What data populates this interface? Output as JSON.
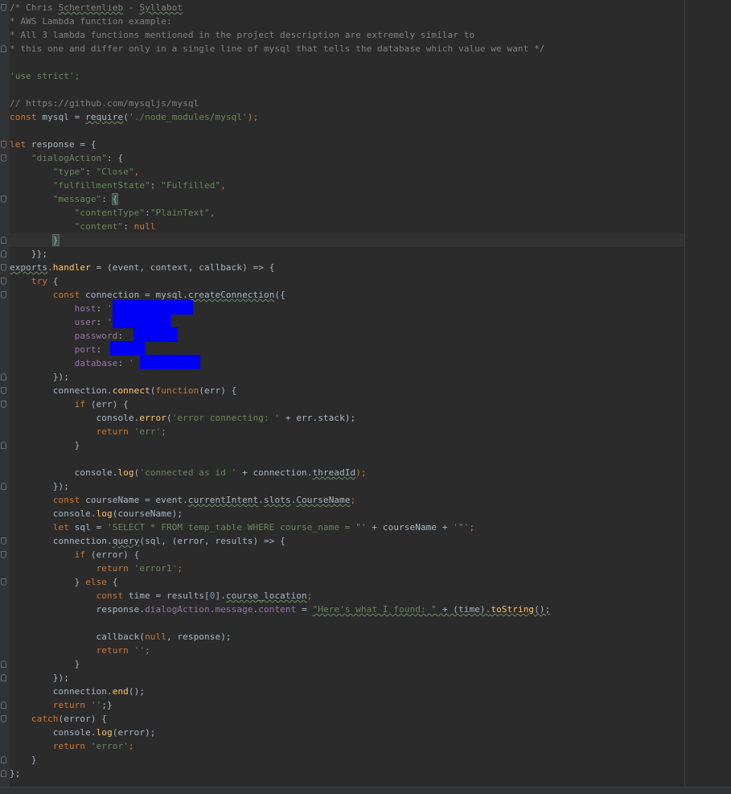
{
  "editor": {
    "colors": {
      "background": "#2b2b2b",
      "gutter": "#313335",
      "comment": "#808080",
      "keyword": "#cc7832",
      "string": "#6a8759",
      "property": "#9876aa",
      "function": "#ffc66d",
      "plain": "#a9b7c6",
      "redaction": "#0000f6"
    },
    "lines": [
      {
        "fold": "start",
        "tokens": [
          {
            "t": "/* Chris ",
            "c": "comment"
          },
          {
            "t": "Schertenlieb",
            "c": "comment typo"
          },
          {
            "t": " - ",
            "c": "comment"
          },
          {
            "t": "Syllabot",
            "c": "comment typo"
          }
        ]
      },
      {
        "tokens": [
          {
            "t": "* AWS Lambda function example:",
            "c": "comment"
          }
        ]
      },
      {
        "tokens": [
          {
            "t": "* All 3 lambda functions mentioned in the project description are extremely similar to",
            "c": "comment"
          }
        ]
      },
      {
        "fold": "end",
        "tokens": [
          {
            "t": "* this one and differ only in a single line of mysql that tells the database which value we want */",
            "c": "comment"
          }
        ]
      },
      {
        "tokens": []
      },
      {
        "tokens": [
          {
            "t": "'use strict';",
            "c": "str"
          }
        ]
      },
      {
        "tokens": []
      },
      {
        "tokens": [
          {
            "t": "// https://github.com/mysqljs/mysql",
            "c": "comment"
          }
        ]
      },
      {
        "tokens": [
          {
            "t": "const",
            "c": "kw"
          },
          {
            "t": " mysql = ",
            "c": "plain"
          },
          {
            "t": "require",
            "c": "plain typo"
          },
          {
            "t": "(",
            "c": "plain"
          },
          {
            "t": "'./node_modules/mysql'",
            "c": "str"
          },
          {
            "t": ");",
            "c": "kw"
          }
        ]
      },
      {
        "tokens": []
      },
      {
        "fold": "start",
        "tokens": [
          {
            "t": "let",
            "c": "kw"
          },
          {
            "t": " response = {",
            "c": "plain"
          }
        ]
      },
      {
        "fold": "start",
        "tokens": [
          {
            "t": "    ",
            "c": "plain"
          },
          {
            "t": "\"dialogAction\"",
            "c": "str"
          },
          {
            "t": ": {",
            "c": "plain"
          }
        ]
      },
      {
        "tokens": [
          {
            "t": "        ",
            "c": "plain"
          },
          {
            "t": "\"type\"",
            "c": "str"
          },
          {
            "t": ": ",
            "c": "plain"
          },
          {
            "t": "\"Close\"",
            "c": "str"
          },
          {
            "t": ",",
            "c": "kw"
          }
        ]
      },
      {
        "tokens": [
          {
            "t": "        ",
            "c": "plain"
          },
          {
            "t": "\"fulfillmentState\"",
            "c": "str"
          },
          {
            "t": ": ",
            "c": "plain"
          },
          {
            "t": "\"Fulfilled\"",
            "c": "str"
          },
          {
            "t": ",",
            "c": "kw"
          }
        ]
      },
      {
        "fold": "start",
        "tokens": [
          {
            "t": "        ",
            "c": "plain"
          },
          {
            "t": "\"message\"",
            "c": "str"
          },
          {
            "t": ": ",
            "c": "plain"
          },
          {
            "t": "{",
            "c": "plain match"
          }
        ]
      },
      {
        "tokens": [
          {
            "t": "            ",
            "c": "plain"
          },
          {
            "t": "\"contentType\"",
            "c": "str"
          },
          {
            "t": ":",
            "c": "plain"
          },
          {
            "t": "\"PlainText\"",
            "c": "str"
          },
          {
            "t": ",",
            "c": "kw"
          }
        ]
      },
      {
        "tokens": [
          {
            "t": "            ",
            "c": "plain"
          },
          {
            "t": "\"content\"",
            "c": "str"
          },
          {
            "t": ": ",
            "c": "plain"
          },
          {
            "t": "null",
            "c": "kw"
          }
        ]
      },
      {
        "fold": "end",
        "current": true,
        "tokens": [
          {
            "t": "        ",
            "c": "plain"
          },
          {
            "t": "}",
            "c": "plain match"
          }
        ]
      },
      {
        "fold": "end",
        "tokens": [
          {
            "t": "    }};",
            "c": "plain"
          }
        ]
      },
      {
        "fold": "start",
        "tokens": [
          {
            "t": "exports",
            "c": "plain typo"
          },
          {
            "t": ".",
            "c": "plain"
          },
          {
            "t": "handler",
            "c": "fn"
          },
          {
            "t": " = (event, context, callback) => {",
            "c": "plain"
          }
        ]
      },
      {
        "fold": "start",
        "tokens": [
          {
            "t": "    ",
            "c": "plain"
          },
          {
            "t": "try",
            "c": "kw"
          },
          {
            "t": " {",
            "c": "plain"
          }
        ]
      },
      {
        "fold": "start",
        "tokens": [
          {
            "t": "        ",
            "c": "plain"
          },
          {
            "t": "const",
            "c": "kw"
          },
          {
            "t": " connection = mysql.",
            "c": "plain"
          },
          {
            "t": "createConnection",
            "c": "plain typo"
          },
          {
            "t": "({",
            "c": "plain"
          }
        ]
      },
      {
        "redact": [
          140,
          100
        ],
        "tokens": [
          {
            "t": "            ",
            "c": "plain"
          },
          {
            "t": "host",
            "c": "prop"
          },
          {
            "t": ": ",
            "c": "plain"
          },
          {
            "t": "'",
            "c": "str"
          },
          {
            "t": "              ",
            "c": "plain"
          },
          {
            "t": ",",
            "c": "kw"
          }
        ]
      },
      {
        "redact": [
          140,
          73
        ],
        "tokens": [
          {
            "t": "            ",
            "c": "plain"
          },
          {
            "t": "user",
            "c": "prop"
          },
          {
            "t": ": ",
            "c": "plain"
          },
          {
            "t": "'",
            "c": "str"
          },
          {
            "t": "          ",
            "c": "plain"
          },
          {
            "t": ",",
            "c": "kw"
          }
        ]
      },
      {
        "redact": [
          166,
          55
        ],
        "tokens": [
          {
            "t": "            ",
            "c": "plain"
          },
          {
            "t": "password",
            "c": "prop"
          },
          {
            "t": ": ",
            "c": "plain"
          },
          {
            "t": "        ",
            "c": "plain"
          },
          {
            "t": ",",
            "c": "kw"
          }
        ]
      },
      {
        "redact": [
          137,
          44
        ],
        "tokens": [
          {
            "t": "            ",
            "c": "plain"
          },
          {
            "t": "port",
            "c": "prop"
          },
          {
            "t": ": ",
            "c": "plain"
          },
          {
            "t": "      ",
            "c": "plain"
          },
          {
            "t": ",",
            "c": "kw"
          }
        ]
      },
      {
        "redact": [
          174,
          75
        ],
        "tokens": [
          {
            "t": "            ",
            "c": "plain"
          },
          {
            "t": "database",
            "c": "prop"
          },
          {
            "t": ": ",
            "c": "plain"
          },
          {
            "t": "'",
            "c": "str"
          }
        ]
      },
      {
        "fold": "end",
        "tokens": [
          {
            "t": "        ",
            "c": "plain"
          },
          {
            "t": "});",
            "c": "plain"
          }
        ]
      },
      {
        "fold": "start",
        "tokens": [
          {
            "t": "        connection.",
            "c": "plain"
          },
          {
            "t": "connect",
            "c": "fn"
          },
          {
            "t": "(",
            "c": "plain"
          },
          {
            "t": "function",
            "c": "kw"
          },
          {
            "t": "(err) {",
            "c": "plain"
          }
        ]
      },
      {
        "fold": "start",
        "tokens": [
          {
            "t": "            ",
            "c": "plain"
          },
          {
            "t": "if",
            "c": "kw"
          },
          {
            "t": " (err) {",
            "c": "plain"
          }
        ]
      },
      {
        "tokens": [
          {
            "t": "                console.",
            "c": "plain"
          },
          {
            "t": "error",
            "c": "fn"
          },
          {
            "t": "(",
            "c": "plain"
          },
          {
            "t": "'error connecting: '",
            "c": "str"
          },
          {
            "t": " + err.stack);",
            "c": "plain"
          }
        ]
      },
      {
        "tokens": [
          {
            "t": "                ",
            "c": "plain"
          },
          {
            "t": "return",
            "c": "kw"
          },
          {
            "t": " ",
            "c": "plain"
          },
          {
            "t": "'err'",
            "c": "str"
          },
          {
            "t": ";",
            "c": "kw"
          }
        ]
      },
      {
        "fold": "end",
        "tokens": [
          {
            "t": "            }",
            "c": "plain"
          }
        ]
      },
      {
        "tokens": []
      },
      {
        "tokens": [
          {
            "t": "            console.",
            "c": "plain"
          },
          {
            "t": "log",
            "c": "fn"
          },
          {
            "t": "(",
            "c": "plain"
          },
          {
            "t": "'connected as id '",
            "c": "str"
          },
          {
            "t": " + connection.",
            "c": "plain"
          },
          {
            "t": "threadId",
            "c": "plain typo"
          },
          {
            "t": ");",
            "c": "kw"
          }
        ]
      },
      {
        "fold": "end",
        "tokens": [
          {
            "t": "        });",
            "c": "plain"
          }
        ]
      },
      {
        "tokens": [
          {
            "t": "        ",
            "c": "plain"
          },
          {
            "t": "const",
            "c": "kw"
          },
          {
            "t": " courseName = event.",
            "c": "plain"
          },
          {
            "t": "currentIntent",
            "c": "plain typo"
          },
          {
            "t": ".",
            "c": "plain"
          },
          {
            "t": "slots",
            "c": "plain typo"
          },
          {
            "t": ".",
            "c": "plain"
          },
          {
            "t": "CourseName",
            "c": "plain typo"
          },
          {
            "t": ";",
            "c": "kw"
          }
        ]
      },
      {
        "tokens": [
          {
            "t": "        console.",
            "c": "plain"
          },
          {
            "t": "log",
            "c": "fn"
          },
          {
            "t": "(courseName);",
            "c": "plain"
          }
        ]
      },
      {
        "tokens": [
          {
            "t": "        ",
            "c": "plain"
          },
          {
            "t": "let",
            "c": "kw"
          },
          {
            "t": " sql = ",
            "c": "plain"
          },
          {
            "t": "'SELECT * FROM temp_table WHERE course_name = \"'",
            "c": "str"
          },
          {
            "t": " + courseName + ",
            "c": "plain"
          },
          {
            "t": "'\"'",
            "c": "str"
          },
          {
            "t": ";",
            "c": "kw"
          }
        ]
      },
      {
        "fold": "start",
        "tokens": [
          {
            "t": "        connection.",
            "c": "plain"
          },
          {
            "t": "query",
            "c": "plain typo"
          },
          {
            "t": "(sql, (error, results) => {",
            "c": "plain"
          }
        ]
      },
      {
        "fold": "start",
        "tokens": [
          {
            "t": "            ",
            "c": "plain"
          },
          {
            "t": "if",
            "c": "kw"
          },
          {
            "t": " (error) {",
            "c": "plain"
          }
        ]
      },
      {
        "tokens": [
          {
            "t": "                ",
            "c": "plain"
          },
          {
            "t": "return",
            "c": "kw"
          },
          {
            "t": " ",
            "c": "plain"
          },
          {
            "t": "'error1'",
            "c": "str"
          },
          {
            "t": ";",
            "c": "kw"
          }
        ]
      },
      {
        "fold": "start",
        "tokens": [
          {
            "t": "            } ",
            "c": "plain"
          },
          {
            "t": "else",
            "c": "kw"
          },
          {
            "t": " {",
            "c": "plain"
          }
        ]
      },
      {
        "tokens": [
          {
            "t": "                ",
            "c": "plain"
          },
          {
            "t": "const",
            "c": "kw"
          },
          {
            "t": " time = results[",
            "c": "plain"
          },
          {
            "t": "0",
            "c": "num"
          },
          {
            "t": "].",
            "c": "plain"
          },
          {
            "t": "course_location",
            "c": "plain typo"
          },
          {
            "t": ";",
            "c": "kw"
          }
        ]
      },
      {
        "tokens": [
          {
            "t": "                response.",
            "c": "plain"
          },
          {
            "t": "dialogAction",
            "c": "prop"
          },
          {
            "t": ".",
            "c": "plain"
          },
          {
            "t": "message",
            "c": "prop"
          },
          {
            "t": ".",
            "c": "plain"
          },
          {
            "t": "content",
            "c": "prop"
          },
          {
            "t": " = ",
            "c": "plain"
          },
          {
            "t": "\"Here's what I found: \"",
            "c": "str typo"
          },
          {
            "t": " + (time).",
            "c": "plain typo"
          },
          {
            "t": "toString",
            "c": "fn typo"
          },
          {
            "t": "();",
            "c": "plain typo"
          }
        ]
      },
      {
        "tokens": []
      },
      {
        "tokens": [
          {
            "t": "                callback(",
            "c": "plain"
          },
          {
            "t": "null",
            "c": "kw"
          },
          {
            "t": ", response);",
            "c": "plain"
          }
        ]
      },
      {
        "tokens": [
          {
            "t": "                ",
            "c": "plain"
          },
          {
            "t": "return",
            "c": "kw"
          },
          {
            "t": " ",
            "c": "plain"
          },
          {
            "t": "''",
            "c": "str"
          },
          {
            "t": ";",
            "c": "kw"
          }
        ]
      },
      {
        "fold": "end",
        "tokens": [
          {
            "t": "            }",
            "c": "plain"
          }
        ]
      },
      {
        "fold": "end",
        "tokens": [
          {
            "t": "        });",
            "c": "plain"
          }
        ]
      },
      {
        "tokens": [
          {
            "t": "        connection.",
            "c": "plain"
          },
          {
            "t": "end",
            "c": "fn"
          },
          {
            "t": "();",
            "c": "plain"
          }
        ]
      },
      {
        "fold": "end",
        "tokens": [
          {
            "t": "        ",
            "c": "plain"
          },
          {
            "t": "return",
            "c": "kw"
          },
          {
            "t": " ",
            "c": "plain"
          },
          {
            "t": "''",
            "c": "str"
          },
          {
            "t": ";}",
            "c": "plain"
          }
        ]
      },
      {
        "fold": "start",
        "tokens": [
          {
            "t": "    ",
            "c": "plain"
          },
          {
            "t": "catch",
            "c": "kw"
          },
          {
            "t": "(error) {",
            "c": "plain"
          }
        ]
      },
      {
        "tokens": [
          {
            "t": "        console.",
            "c": "plain"
          },
          {
            "t": "log",
            "c": "fn"
          },
          {
            "t": "(error);",
            "c": "plain"
          }
        ]
      },
      {
        "tokens": [
          {
            "t": "        ",
            "c": "plain"
          },
          {
            "t": "return",
            "c": "kw"
          },
          {
            "t": " ",
            "c": "plain"
          },
          {
            "t": "'error'",
            "c": "str"
          },
          {
            "t": ";",
            "c": "kw"
          }
        ]
      },
      {
        "fold": "end",
        "tokens": [
          {
            "t": "    }",
            "c": "plain"
          }
        ]
      },
      {
        "fold": "end",
        "tokens": [
          {
            "t": "};",
            "c": "plain"
          }
        ]
      }
    ]
  }
}
